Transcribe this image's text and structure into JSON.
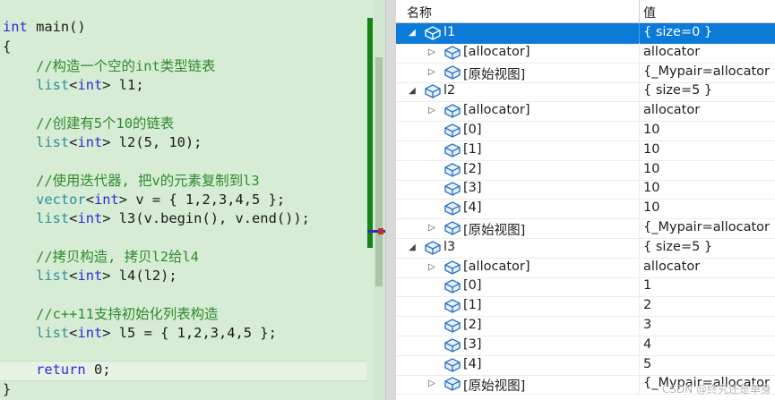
{
  "editor": {
    "lines": [
      [
        {
          "c": "kw",
          "t": "int"
        },
        {
          "c": "pl",
          "t": " main()"
        }
      ],
      [
        {
          "c": "pl",
          "t": "{"
        }
      ],
      [
        {
          "c": "cm",
          "t": "    //构造一个空的int类型链表"
        }
      ],
      [
        {
          "c": "pl",
          "t": "    "
        },
        {
          "c": "tp",
          "t": "list"
        },
        {
          "c": "pl",
          "t": "<"
        },
        {
          "c": "kw",
          "t": "int"
        },
        {
          "c": "pl",
          "t": "> l1;"
        }
      ],
      [],
      [
        {
          "c": "cm",
          "t": "    //创建有5个10的链表"
        }
      ],
      [
        {
          "c": "pl",
          "t": "    "
        },
        {
          "c": "tp",
          "t": "list"
        },
        {
          "c": "pl",
          "t": "<"
        },
        {
          "c": "kw",
          "t": "int"
        },
        {
          "c": "pl",
          "t": "> l2(5, 10);"
        }
      ],
      [],
      [
        {
          "c": "cm",
          "t": "    //使用迭代器, 把v的元素复制到l3"
        }
      ],
      [
        {
          "c": "pl",
          "t": "    "
        },
        {
          "c": "tp",
          "t": "vector"
        },
        {
          "c": "pl",
          "t": "<"
        },
        {
          "c": "kw",
          "t": "int"
        },
        {
          "c": "pl",
          "t": "> v = { 1,2,3,4,5 };"
        }
      ],
      [
        {
          "c": "pl",
          "t": "    "
        },
        {
          "c": "tp",
          "t": "list"
        },
        {
          "c": "pl",
          "t": "<"
        },
        {
          "c": "kw",
          "t": "int"
        },
        {
          "c": "pl",
          "t": "> l3(v.begin(), v.end());"
        }
      ],
      [],
      [
        {
          "c": "cm",
          "t": "    //拷贝构造, 拷贝l2给l4"
        }
      ],
      [
        {
          "c": "pl",
          "t": "    "
        },
        {
          "c": "tp",
          "t": "list"
        },
        {
          "c": "pl",
          "t": "<"
        },
        {
          "c": "kw",
          "t": "int"
        },
        {
          "c": "pl",
          "t": "> l4(l2);"
        }
      ],
      [],
      [
        {
          "c": "cm",
          "t": "    //c++11支持初始化列表构造"
        }
      ],
      [
        {
          "c": "pl",
          "t": "    "
        },
        {
          "c": "tp",
          "t": "list"
        },
        {
          "c": "pl",
          "t": "<"
        },
        {
          "c": "kw",
          "t": "int"
        },
        {
          "c": "pl",
          "t": "> l5 = { 1,2,3,4,5 };"
        }
      ],
      [],
      [
        {
          "c": "pl",
          "t": "    "
        },
        {
          "c": "kw",
          "t": "return"
        },
        {
          "c": "pl",
          "t": " 0;"
        }
      ],
      [
        {
          "c": "pl",
          "t": "}"
        }
      ]
    ]
  },
  "watch": {
    "headers": {
      "name": "名称",
      "value": "值"
    },
    "rows": [
      {
        "depth": 0,
        "toggle": "expanded",
        "name": "l1",
        "value": "{ size=0 }",
        "selected": true
      },
      {
        "depth": 1,
        "toggle": "collapsed",
        "name": "[allocator]",
        "value": "allocator"
      },
      {
        "depth": 1,
        "toggle": "collapsed",
        "name": "[原始视图]",
        "value": "{_Mypair=allocator }"
      },
      {
        "depth": 0,
        "toggle": "expanded",
        "name": "l2",
        "value": "{ size=5 }"
      },
      {
        "depth": 1,
        "toggle": "collapsed",
        "name": "[allocator]",
        "value": "allocator"
      },
      {
        "depth": 1,
        "toggle": "none",
        "name": "[0]",
        "value": "10"
      },
      {
        "depth": 1,
        "toggle": "none",
        "name": "[1]",
        "value": "10"
      },
      {
        "depth": 1,
        "toggle": "none",
        "name": "[2]",
        "value": "10"
      },
      {
        "depth": 1,
        "toggle": "none",
        "name": "[3]",
        "value": "10"
      },
      {
        "depth": 1,
        "toggle": "none",
        "name": "[4]",
        "value": "10"
      },
      {
        "depth": 1,
        "toggle": "collapsed",
        "name": "[原始视图]",
        "value": "{_Mypair=allocator }"
      },
      {
        "depth": 0,
        "toggle": "expanded",
        "name": "l3",
        "value": "{ size=5 }"
      },
      {
        "depth": 1,
        "toggle": "collapsed",
        "name": "[allocator]",
        "value": "allocator"
      },
      {
        "depth": 1,
        "toggle": "none",
        "name": "[0]",
        "value": "1"
      },
      {
        "depth": 1,
        "toggle": "none",
        "name": "[1]",
        "value": "2"
      },
      {
        "depth": 1,
        "toggle": "none",
        "name": "[2]",
        "value": "3"
      },
      {
        "depth": 1,
        "toggle": "none",
        "name": "[3]",
        "value": "4"
      },
      {
        "depth": 1,
        "toggle": "none",
        "name": "[4]",
        "value": "5"
      },
      {
        "depth": 1,
        "toggle": "collapsed",
        "name": "[原始视图]",
        "value": "{_Mypair=allocator }"
      }
    ],
    "watermark": "CSDN @终究还是单身"
  },
  "colors": {
    "editor_bg": "#d7ecd5",
    "keyword": "#2b2bd6",
    "type": "#2e8f98",
    "comment": "#2f8b2f",
    "selection": "#0c7ad8",
    "cube_icon": "#2a73c7"
  },
  "icons": {
    "expanded": "expanded-triangle-icon",
    "collapsed": "collapsed-triangle-icon",
    "variable": "variable-cube-icon"
  }
}
